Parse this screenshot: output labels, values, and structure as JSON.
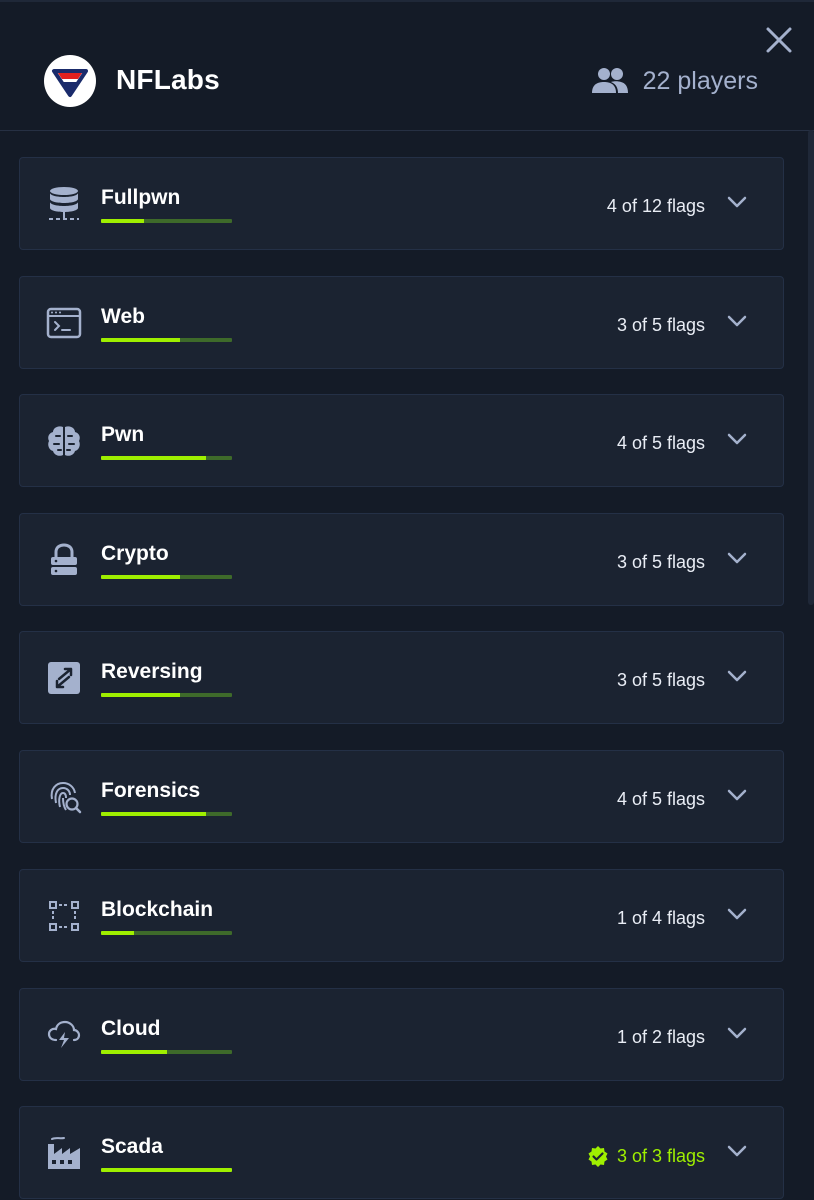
{
  "header": {
    "team_name": "NFLabs",
    "players_label": "22 players"
  },
  "colors": {
    "background": "#141b27",
    "card": "#1b2331",
    "accent": "#9fef00",
    "muted": "#a4b1cd"
  },
  "categories": [
    {
      "name": "Fullpwn",
      "flags": "4 of 12 flags",
      "progress": 0.33,
      "icon": "database-icon",
      "complete": false
    },
    {
      "name": "Web",
      "flags": "3 of 5 flags",
      "progress": 0.6,
      "icon": "terminal-window-icon",
      "complete": false
    },
    {
      "name": "Pwn",
      "flags": "4 of 5 flags",
      "progress": 0.8,
      "icon": "brain-icon",
      "complete": false
    },
    {
      "name": "Crypto",
      "flags": "3 of 5 flags",
      "progress": 0.6,
      "icon": "lock-icon",
      "complete": false
    },
    {
      "name": "Reversing",
      "flags": "3 of 5 flags",
      "progress": 0.6,
      "icon": "reverse-arrows-icon",
      "complete": false
    },
    {
      "name": "Forensics",
      "flags": "4 of 5 flags",
      "progress": 0.8,
      "icon": "fingerprint-search-icon",
      "complete": false
    },
    {
      "name": "Blockchain",
      "flags": "1 of 4 flags",
      "progress": 0.25,
      "icon": "blockchain-nodes-icon",
      "complete": false
    },
    {
      "name": "Cloud",
      "flags": "1 of 2 flags",
      "progress": 0.5,
      "icon": "cloud-bolt-icon",
      "complete": false
    },
    {
      "name": "Scada",
      "flags": "3 of 3 flags",
      "progress": 1.0,
      "icon": "factory-icon",
      "complete": true
    }
  ]
}
